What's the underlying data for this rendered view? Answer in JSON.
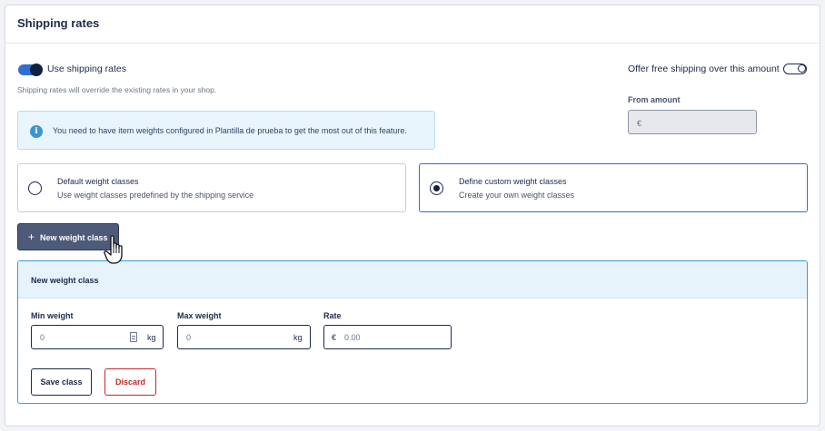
{
  "panel": {
    "title": "Shipping rates"
  },
  "shipping_toggle": {
    "label": "Use shipping rates",
    "on": true,
    "hint": "Shipping rates will override the existing rates in your shop."
  },
  "free_shipping": {
    "label": "Offer free shipping over this amount",
    "on": false,
    "amount_label": "From amount",
    "currency": "€"
  },
  "info": {
    "text": "You need to have item weights configured in Plantilla de prueba to get the most out of this feature."
  },
  "options": [
    {
      "title": "Default weight classes",
      "subtitle": "Use weight classes predefined by the shipping service",
      "selected": false
    },
    {
      "title": "Define custom weight classes",
      "subtitle": "Create your own weight classes",
      "selected": true
    }
  ],
  "new_class_button": {
    "icon": "+",
    "label": "New weight class"
  },
  "form": {
    "title": "New weight class",
    "min_weight": {
      "label": "Min weight",
      "placeholder": "0",
      "unit": "kg"
    },
    "max_weight": {
      "label": "Max weight",
      "placeholder": "0",
      "unit": "kg"
    },
    "rate": {
      "label": "Rate",
      "currency": "€",
      "placeholder": "0.00"
    },
    "save_label": "Save class",
    "discard_label": "Discard"
  },
  "colors": {
    "accent": "#2f6fd1",
    "primary_dark": "#12213f",
    "danger": "#c62828",
    "info_bg": "#e9f5fc"
  }
}
